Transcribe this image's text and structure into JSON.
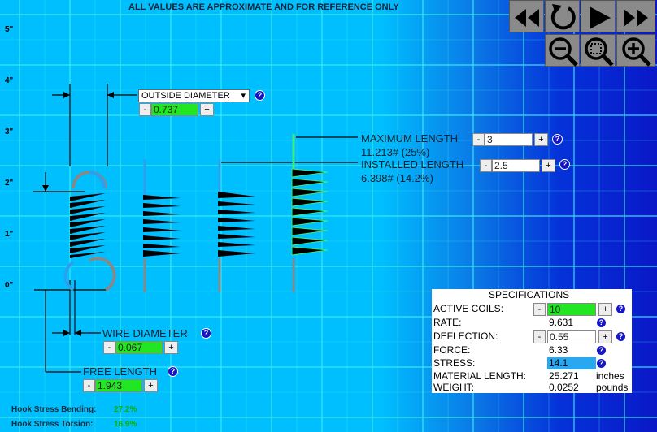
{
  "notice": "ALL VALUES ARE APPROXIMATE AND FOR REFERENCE ONLY",
  "y_axis_labels": [
    "5\"",
    "4\"",
    "3\"",
    "2\"",
    "1\"",
    "0\""
  ],
  "controls": {
    "rewind": "rewind-icon",
    "reset": "reset-icon",
    "play": "play-icon",
    "fast_forward": "fast-forward-icon",
    "zoom_out": "zoom-out-icon",
    "zoom_fit": "zoom-fit-icon",
    "zoom_in": "zoom-in-icon"
  },
  "outside_diameter": {
    "selected": "OUTSIDE DIAMETER",
    "value": "0.737"
  },
  "maximum_length": {
    "label": "MAXIMUM LENGTH",
    "value": "3",
    "load": "11.213# (25%)"
  },
  "installed_length": {
    "label": "INSTALLED LENGTH",
    "value": "2.5",
    "load": "6.398# (14.2%)"
  },
  "wire_diameter": {
    "label": "WIRE DIAMETER",
    "value": "0.067"
  },
  "free_length": {
    "label": "FREE LENGTH",
    "value": "1.943"
  },
  "buttons": {
    "minus": "-",
    "plus": "+",
    "help": "?",
    "dropdown": "▾"
  },
  "specifications": {
    "title": "SPECIFICATIONS",
    "active_coils": {
      "label": "ACTIVE COILS:",
      "value": "10"
    },
    "rate": {
      "label": "RATE:",
      "value": "9.631"
    },
    "deflection": {
      "label": "DEFLECTION:",
      "value": "0.55"
    },
    "force": {
      "label": "FORCE:",
      "value": "6.33"
    },
    "stress": {
      "label": "STRESS:",
      "value": "14.1"
    },
    "material_length": {
      "label": "MATERIAL LENGTH:",
      "value": "25.271",
      "unit": "inches"
    },
    "weight": {
      "label": "WEIGHT:",
      "value": "0.0252",
      "unit": "pounds"
    }
  },
  "hook_stress_bending": {
    "label": "Hook Stress Bending:",
    "value": "27.2%"
  },
  "hook_stress_torsion": {
    "label": "Hook Stress Torsion:",
    "value": "16.9%"
  },
  "colors": {
    "accent_green": "#22e622",
    "help_blue": "#1515c8",
    "stress_blue": "#29a8f0"
  }
}
